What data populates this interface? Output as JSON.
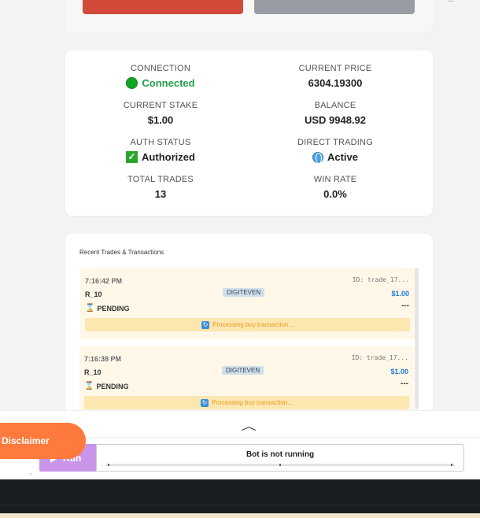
{
  "stats": {
    "connection": {
      "label": "CONNECTION",
      "value": "Connected"
    },
    "current_price": {
      "label": "CURRENT PRICE",
      "value": "6304.19300"
    },
    "current_stake": {
      "label": "CURRENT STAKE",
      "value": "$1.00"
    },
    "balance": {
      "label": "BALANCE",
      "value": "USD 9948.92"
    },
    "auth_status": {
      "label": "AUTH STATUS",
      "value": "Authorized"
    },
    "direct_trading": {
      "label": "DIRECT TRADING",
      "value": "Active"
    },
    "total_trades": {
      "label": "TOTAL TRADES",
      "value": "13"
    },
    "win_rate": {
      "label": "WIN RATE",
      "value": "0.0%"
    }
  },
  "trades_panel": {
    "title": "Recent Trades & Transactions",
    "trades": [
      {
        "time": "7:16:42 PM",
        "id": "ID: trade_17...",
        "symbol": "R_10",
        "type": "DIGITEVEN",
        "amount": "$1.00",
        "status": "PENDING",
        "profit": "---",
        "note": "Processing buy transaction..."
      },
      {
        "time": "7:16:38 PM",
        "id": "ID: trade_17...",
        "symbol": "R_10",
        "type": "DIGITEVEN",
        "amount": "$1.00",
        "status": "PENDING",
        "profit": "---",
        "note": "Processing buy transaction..."
      }
    ]
  },
  "drawer": {
    "run_label": "Run",
    "status": "Bot is not running"
  },
  "disclaimer_label": "Disclaimer",
  "colors": {
    "connected_green": "#22a04b",
    "amount_blue": "#1e78d7",
    "disclaimer_orange": "#ff7a3c",
    "run_purple": "#c895e8"
  },
  "icons": [
    "green-dot-icon",
    "check-icon",
    "globe-icon",
    "hourglass-icon",
    "sync-icon",
    "chevron-up-icon",
    "play-icon"
  ]
}
